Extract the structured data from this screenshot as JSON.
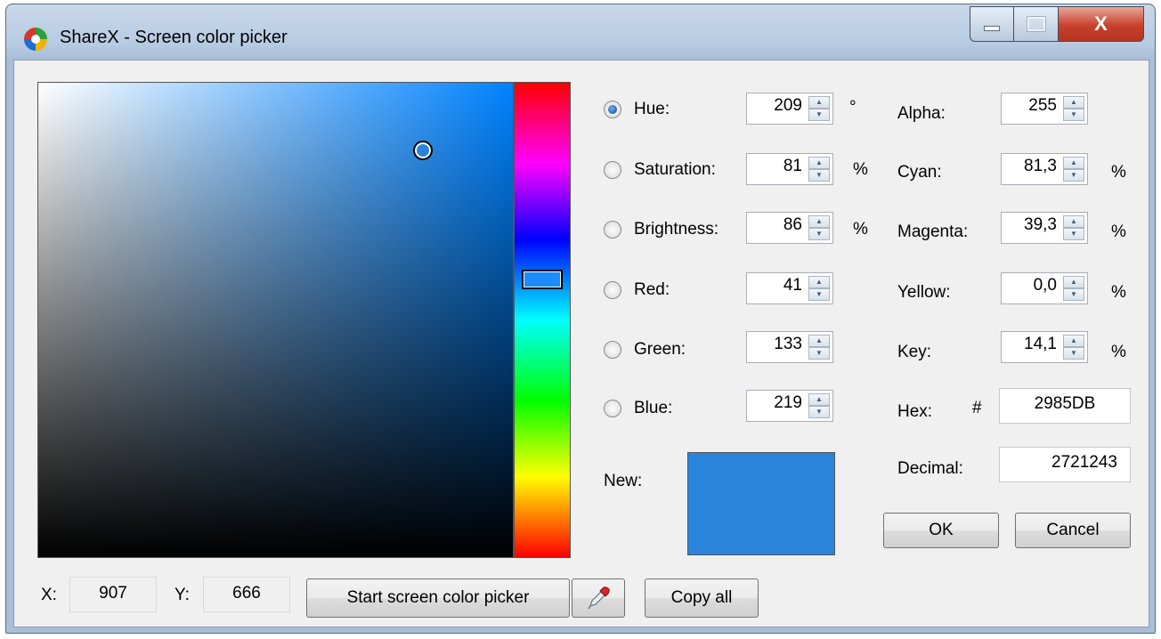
{
  "window": {
    "title": "ShareX - Screen color picker",
    "close_glyph": "X"
  },
  "hsb": {
    "hue": {
      "label": "Hue:",
      "value": "209",
      "unit": "°",
      "selected": true
    },
    "saturation": {
      "label": "Saturation:",
      "value": "81",
      "unit": "%"
    },
    "brightness": {
      "label": "Brightness:",
      "value": "86",
      "unit": "%"
    }
  },
  "rgb": {
    "red": {
      "label": "Red:",
      "value": "41"
    },
    "green": {
      "label": "Green:",
      "value": "133"
    },
    "blue": {
      "label": "Blue:",
      "value": "219"
    }
  },
  "alpha": {
    "label": "Alpha:",
    "value": "255"
  },
  "cmyk": {
    "cyan": {
      "label": "Cyan:",
      "value": "81,3",
      "unit": "%"
    },
    "magenta": {
      "label": "Magenta:",
      "value": "39,3",
      "unit": "%"
    },
    "yellow": {
      "label": "Yellow:",
      "value": "0,0",
      "unit": "%"
    },
    "key": {
      "label": "Key:",
      "value": "14,1",
      "unit": "%"
    }
  },
  "hex": {
    "label": "Hex:",
    "prefix": "#",
    "value": "2985DB"
  },
  "decimal": {
    "label": "Decimal:",
    "value": "2721243"
  },
  "new_color": {
    "label": "New:",
    "color": "#2985DB"
  },
  "coords": {
    "x_label": "X:",
    "x_value": "907",
    "y_label": "Y:",
    "y_value": "666"
  },
  "buttons": {
    "ok": "OK",
    "cancel": "Cancel",
    "start_picker": "Start screen color picker",
    "copy_all": "Copy all"
  }
}
